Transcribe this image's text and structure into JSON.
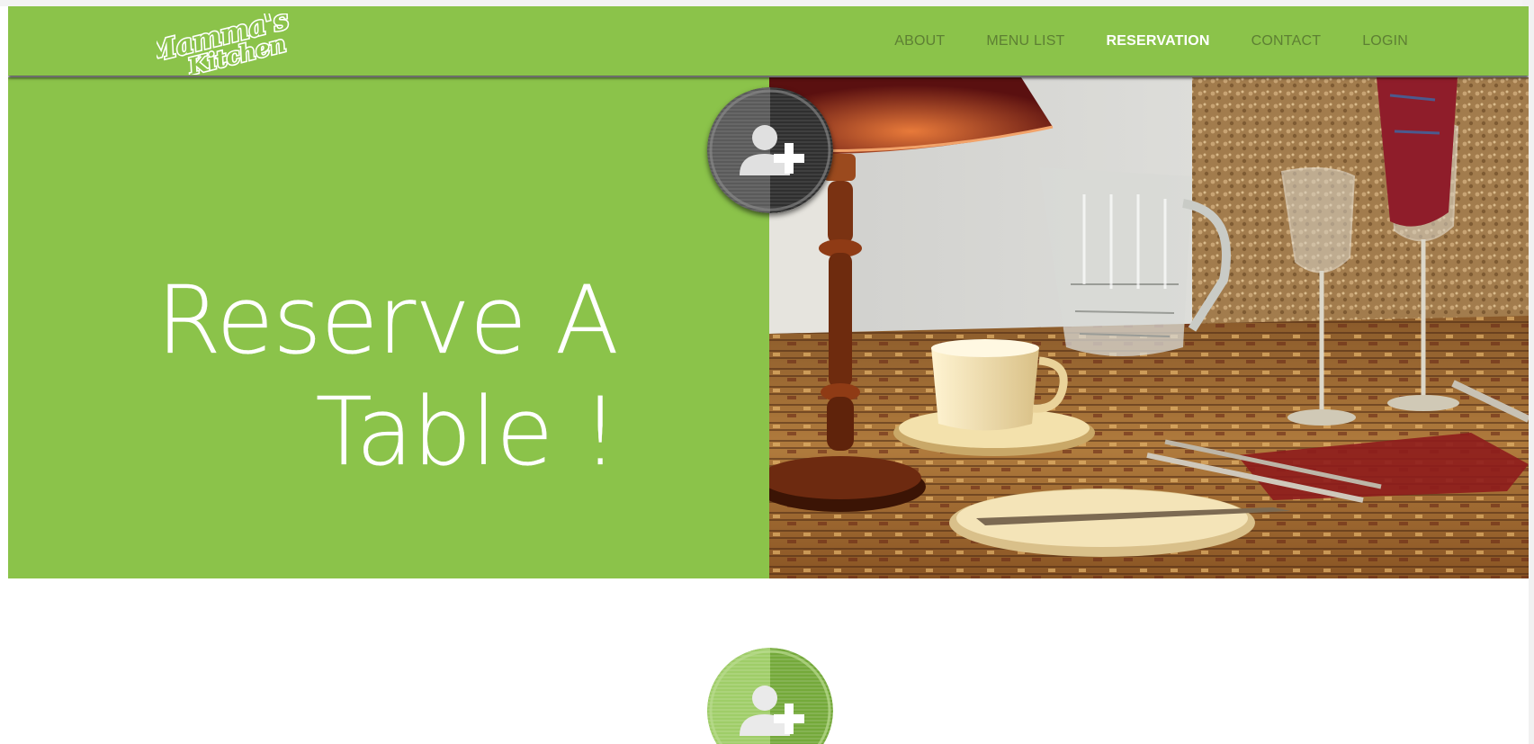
{
  "site": {
    "logo": {
      "line1": "Mamma's",
      "line2": "Kitchen"
    },
    "nav": [
      {
        "label": "ABOUT"
      },
      {
        "label": "MENU LIST"
      },
      {
        "label": "RESERVATION",
        "active": true
      },
      {
        "label": "CONTACT"
      },
      {
        "label": "LOGIN"
      }
    ]
  },
  "hero": {
    "title_line1": "Reserve A",
    "title_line2": "Table !",
    "image": "restaurant-table-photo"
  },
  "icons": {
    "hero_badge": "add-user-icon",
    "section_badge": "add-user-icon"
  },
  "colors": {
    "brand_green": "#8bc34a",
    "nav_text": "#5d7f33",
    "nav_active": "#ffffff",
    "badge_dark": "#3a3a3a"
  }
}
